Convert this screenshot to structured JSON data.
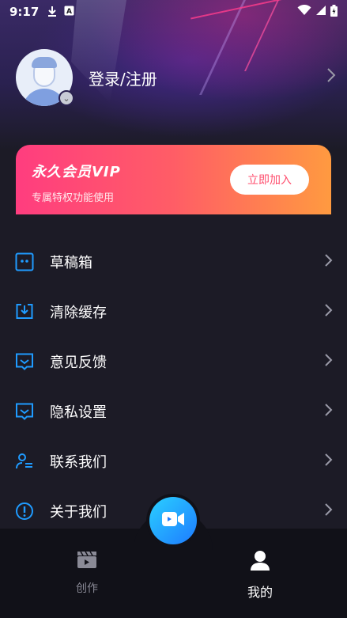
{
  "status_bar": {
    "time": "9:17",
    "icons": [
      "download-icon",
      "a-notification-icon",
      "wifi-icon",
      "cell-signal-icon",
      "battery-icon"
    ]
  },
  "profile": {
    "login_label": "登录/注册"
  },
  "vip": {
    "title": "永久会员VIP",
    "subtitle": "专属特权功能使用",
    "join_label": "立即加入"
  },
  "menu": {
    "items": [
      {
        "label": "草稿箱",
        "icon": "drafts-icon"
      },
      {
        "label": "清除缓存",
        "icon": "clear-cache-icon"
      },
      {
        "label": "意见反馈",
        "icon": "feedback-icon"
      },
      {
        "label": "隐私设置",
        "icon": "privacy-icon"
      },
      {
        "label": "联系我们",
        "icon": "contact-icon"
      },
      {
        "label": "关于我们",
        "icon": "info-icon"
      }
    ]
  },
  "bottom_nav": {
    "tabs": [
      {
        "label": "创作",
        "icon": "clapperboard-icon",
        "active": false
      },
      {
        "label": "我的",
        "icon": "person-icon",
        "active": true
      }
    ],
    "center_button_icon": "video-camera-icon"
  },
  "colors": {
    "background": "#1c1b26",
    "accent_blue": "#1f9bff",
    "vip_gradient_start": "#ff3d7f",
    "vip_gradient_end": "#ff9a40"
  }
}
